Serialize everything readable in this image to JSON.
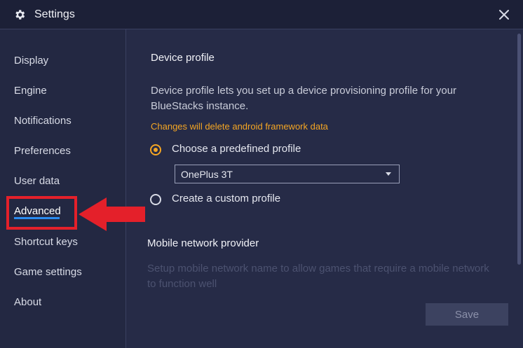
{
  "window": {
    "title": "Settings",
    "icon": "gear-icon",
    "close_icon": "close-icon"
  },
  "sidebar": {
    "items": [
      {
        "label": "Display"
      },
      {
        "label": "Engine"
      },
      {
        "label": "Notifications"
      },
      {
        "label": "Preferences"
      },
      {
        "label": "User data"
      },
      {
        "label": "Advanced",
        "active": true
      },
      {
        "label": "Shortcut keys"
      },
      {
        "label": "Game settings"
      },
      {
        "label": "About"
      }
    ]
  },
  "device_profile": {
    "title": "Device profile",
    "description": "Device profile lets you set up a device provisioning profile for your BlueStacks instance.",
    "warning": "Changes will delete android framework data",
    "option_predefined": "Choose a predefined profile",
    "option_custom": "Create a custom profile",
    "selected_option": "predefined",
    "profile_value": "OnePlus 3T"
  },
  "mobile_network": {
    "title": "Mobile network provider",
    "description": "Setup mobile network name to allow games that require a mobile network to function well"
  },
  "actions": {
    "save_label": "Save"
  },
  "colors": {
    "accent": "#f5a623",
    "active_underline": "#2b8bf0",
    "annotation": "#e4202a",
    "background": "#262b47"
  }
}
